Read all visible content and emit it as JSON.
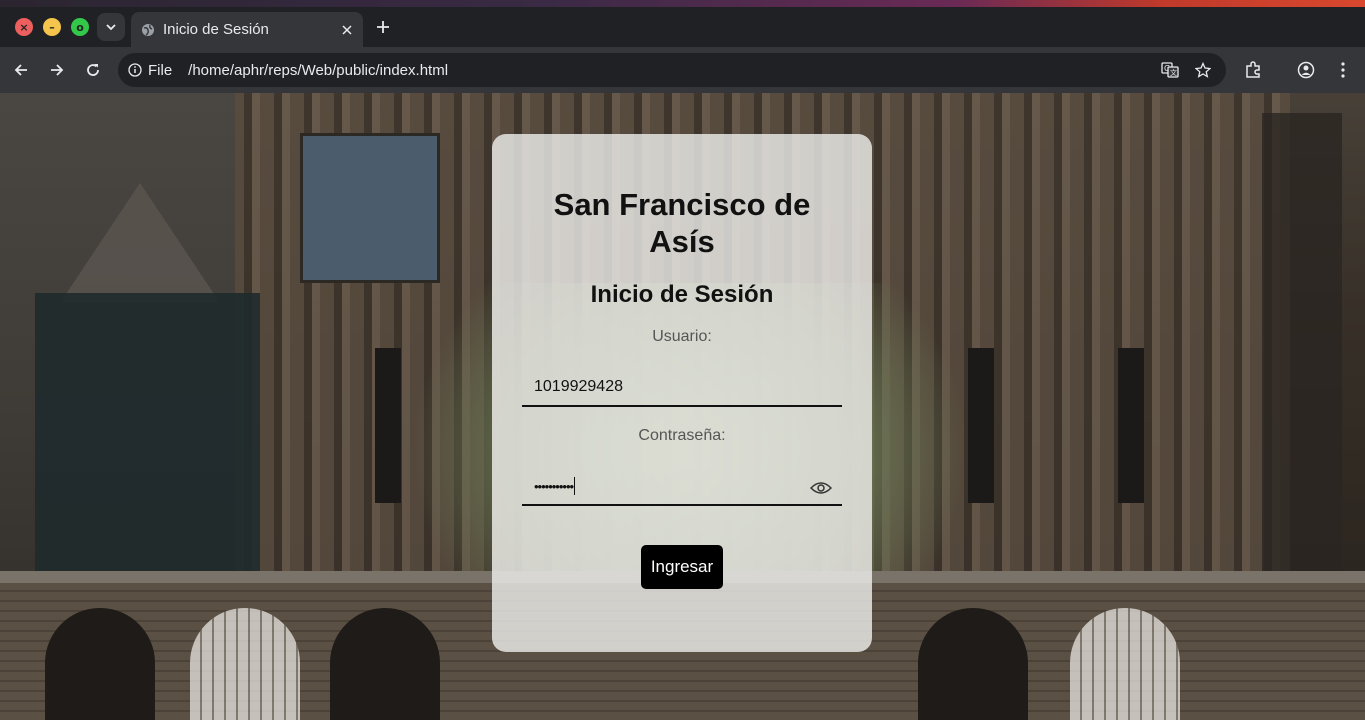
{
  "browser": {
    "tab_title": "Inicio de Sesión",
    "omnibox_scheme": "File",
    "omnibox_url": "/home/aphr/reps/Web/public/index.html",
    "icons": {
      "window_close": "close-icon",
      "window_minimize": "minimize-icon",
      "window_maximize": "maximize-icon",
      "tab_search": "chevron-down-icon",
      "favicon": "globe-icon",
      "tab_close": "close-icon",
      "new_tab": "plus-icon",
      "back": "arrow-left-icon",
      "forward": "arrow-right-icon",
      "reload": "reload-icon",
      "site_info": "info-icon",
      "translate": "translate-icon",
      "bookmark": "star-icon",
      "extensions": "puzzle-icon",
      "profile": "profile-icon",
      "menu": "kebab-menu-icon"
    },
    "window_buttons": {
      "close": "×",
      "minimize": "–",
      "maximize": "o"
    }
  },
  "login": {
    "school_name": "San Francisco de Asís",
    "heading": "Inicio de Sesión",
    "username_label": "Usuario:",
    "username_value": "1019929428",
    "password_label": "Contraseña:",
    "password_masked": "•••••••••••",
    "submit_label": "Ingresar"
  },
  "colors": {
    "chrome_bg": "#202124",
    "toolbar_bg": "#35363a",
    "card_bg": "#f0f0ee",
    "button_bg": "#000000"
  }
}
